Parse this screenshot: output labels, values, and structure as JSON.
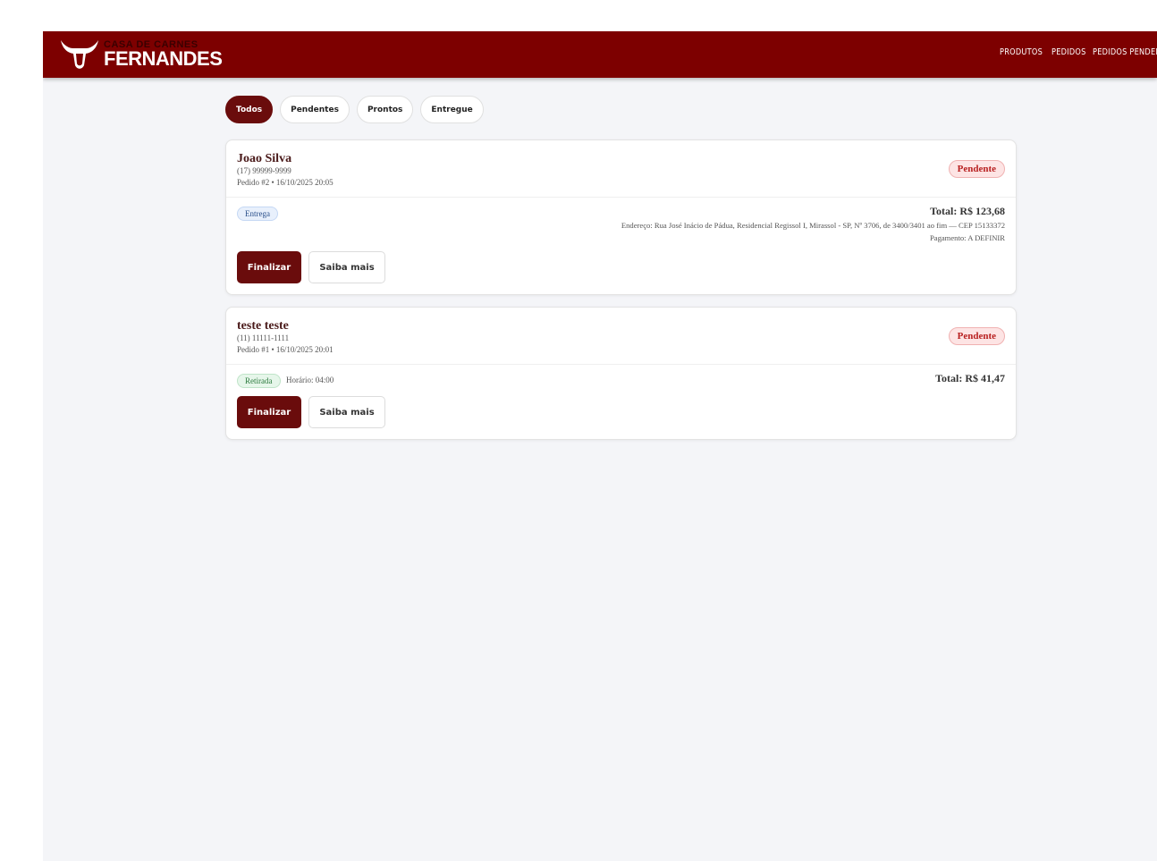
{
  "brand": {
    "small": "CASA DE CARNES",
    "big": "FERNANDES"
  },
  "nav": [
    "PRODUTOS",
    "PEDIDOS",
    "PEDIDOS PENDENTES"
  ],
  "filters": [
    {
      "label": "Todos",
      "active": true
    },
    {
      "label": "Pendentes",
      "active": false
    },
    {
      "label": "Prontos",
      "active": false
    },
    {
      "label": "Entregue",
      "active": false
    }
  ],
  "orders": [
    {
      "name": "Joao Silva",
      "phone": "(17) 99999-9999",
      "meta": "Pedido #2 • 16/10/2025 20:05",
      "status": "Pendente",
      "type": "Entrega",
      "total": "Total: R$ 123,68",
      "address": "Endereço: Rua José Inácio de Pádua, Residencial Regissol I, Mirassol - SP, Nº 3706, de 3400/3401 ao fim — CEP 15133372",
      "payment": "Pagamento: A DEFINIR",
      "primary_label": "Finalizar",
      "secondary_label": "Saiba mais"
    },
    {
      "name": "teste teste",
      "phone": "(11) 11111-1111",
      "meta": "Pedido #1 • 16/10/2025 20:01",
      "status": "Pendente",
      "type": "Retirada",
      "schedule": "Horário: 04:00",
      "total": "Total: R$ 41,47",
      "primary_label": "Finalizar",
      "secondary_label": "Saiba mais"
    }
  ],
  "colors": {
    "brand": "#7d0000",
    "button": "#6a0c0c",
    "status_text": "#b82020",
    "background": "#f4f5f8"
  }
}
